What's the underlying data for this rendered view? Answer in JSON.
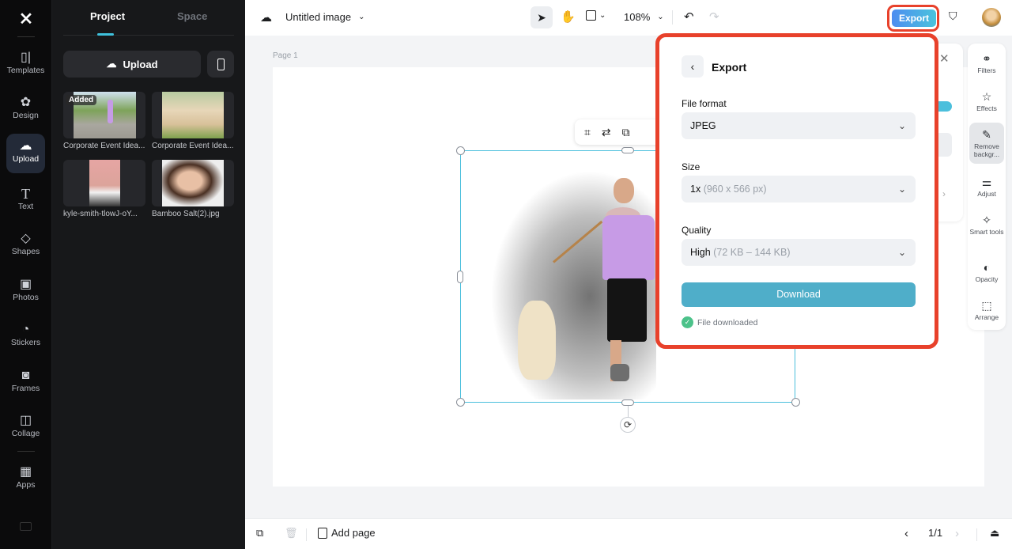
{
  "rail": {
    "logo": "capcut-logo",
    "items": [
      {
        "label": "Templates",
        "icon": "▯|"
      },
      {
        "label": "Design",
        "icon": "✿"
      },
      {
        "label": "Upload",
        "icon": "☁",
        "active": true
      },
      {
        "label": "Text",
        "icon": "T"
      },
      {
        "label": "Shapes",
        "icon": "◇"
      },
      {
        "label": "Photos",
        "icon": "▣"
      },
      {
        "label": "Stickers",
        "icon": "◔"
      },
      {
        "label": "Frames",
        "icon": "◙"
      },
      {
        "label": "Collage",
        "icon": "◫"
      },
      {
        "label": "Apps",
        "icon": "▦"
      }
    ]
  },
  "panel": {
    "tabs": [
      {
        "label": "Project",
        "active": true
      },
      {
        "label": "Space"
      }
    ],
    "upload_label": "Upload",
    "assets": [
      {
        "caption": "Corporate Event Idea...",
        "badge": "Added"
      },
      {
        "caption": "Corporate Event Idea..."
      },
      {
        "caption": "kyle-smith-tlowJ-oY..."
      },
      {
        "caption": "Bamboo Salt(2).jpg"
      }
    ]
  },
  "topbar": {
    "doc_title": "Untitled image",
    "zoom": "108%",
    "export_label": "Export"
  },
  "canvas": {
    "page_label": "Page 1"
  },
  "export_panel": {
    "title": "Export",
    "file_format_label": "File format",
    "file_format_value": "JPEG",
    "size_label": "Size",
    "size_value": "1x",
    "size_detail": "(960 x 566 px)",
    "quality_label": "Quality",
    "quality_value": "High",
    "quality_detail": "(72 KB – 144 KB)",
    "download_label": "Download",
    "status": "File downloaded"
  },
  "right_tools": [
    {
      "label": "Filters",
      "icon": "⚭"
    },
    {
      "label": "Effects",
      "icon": "☆"
    },
    {
      "label": "Remove backgr...",
      "icon": "✎",
      "active": true
    },
    {
      "label": "Adjust",
      "icon": "⚌"
    },
    {
      "label": "Smart tools",
      "icon": "✧"
    },
    {
      "label": "Opacity",
      "icon": "◐"
    },
    {
      "label": "Arrange",
      "icon": "⬚"
    }
  ],
  "bottombar": {
    "add_page_label": "Add page",
    "page_counter": "1/1"
  },
  "colors": {
    "accent": "#4bbfdc",
    "highlight": "#e8412b",
    "download": "#4faec9",
    "success": "#4cc28a"
  }
}
